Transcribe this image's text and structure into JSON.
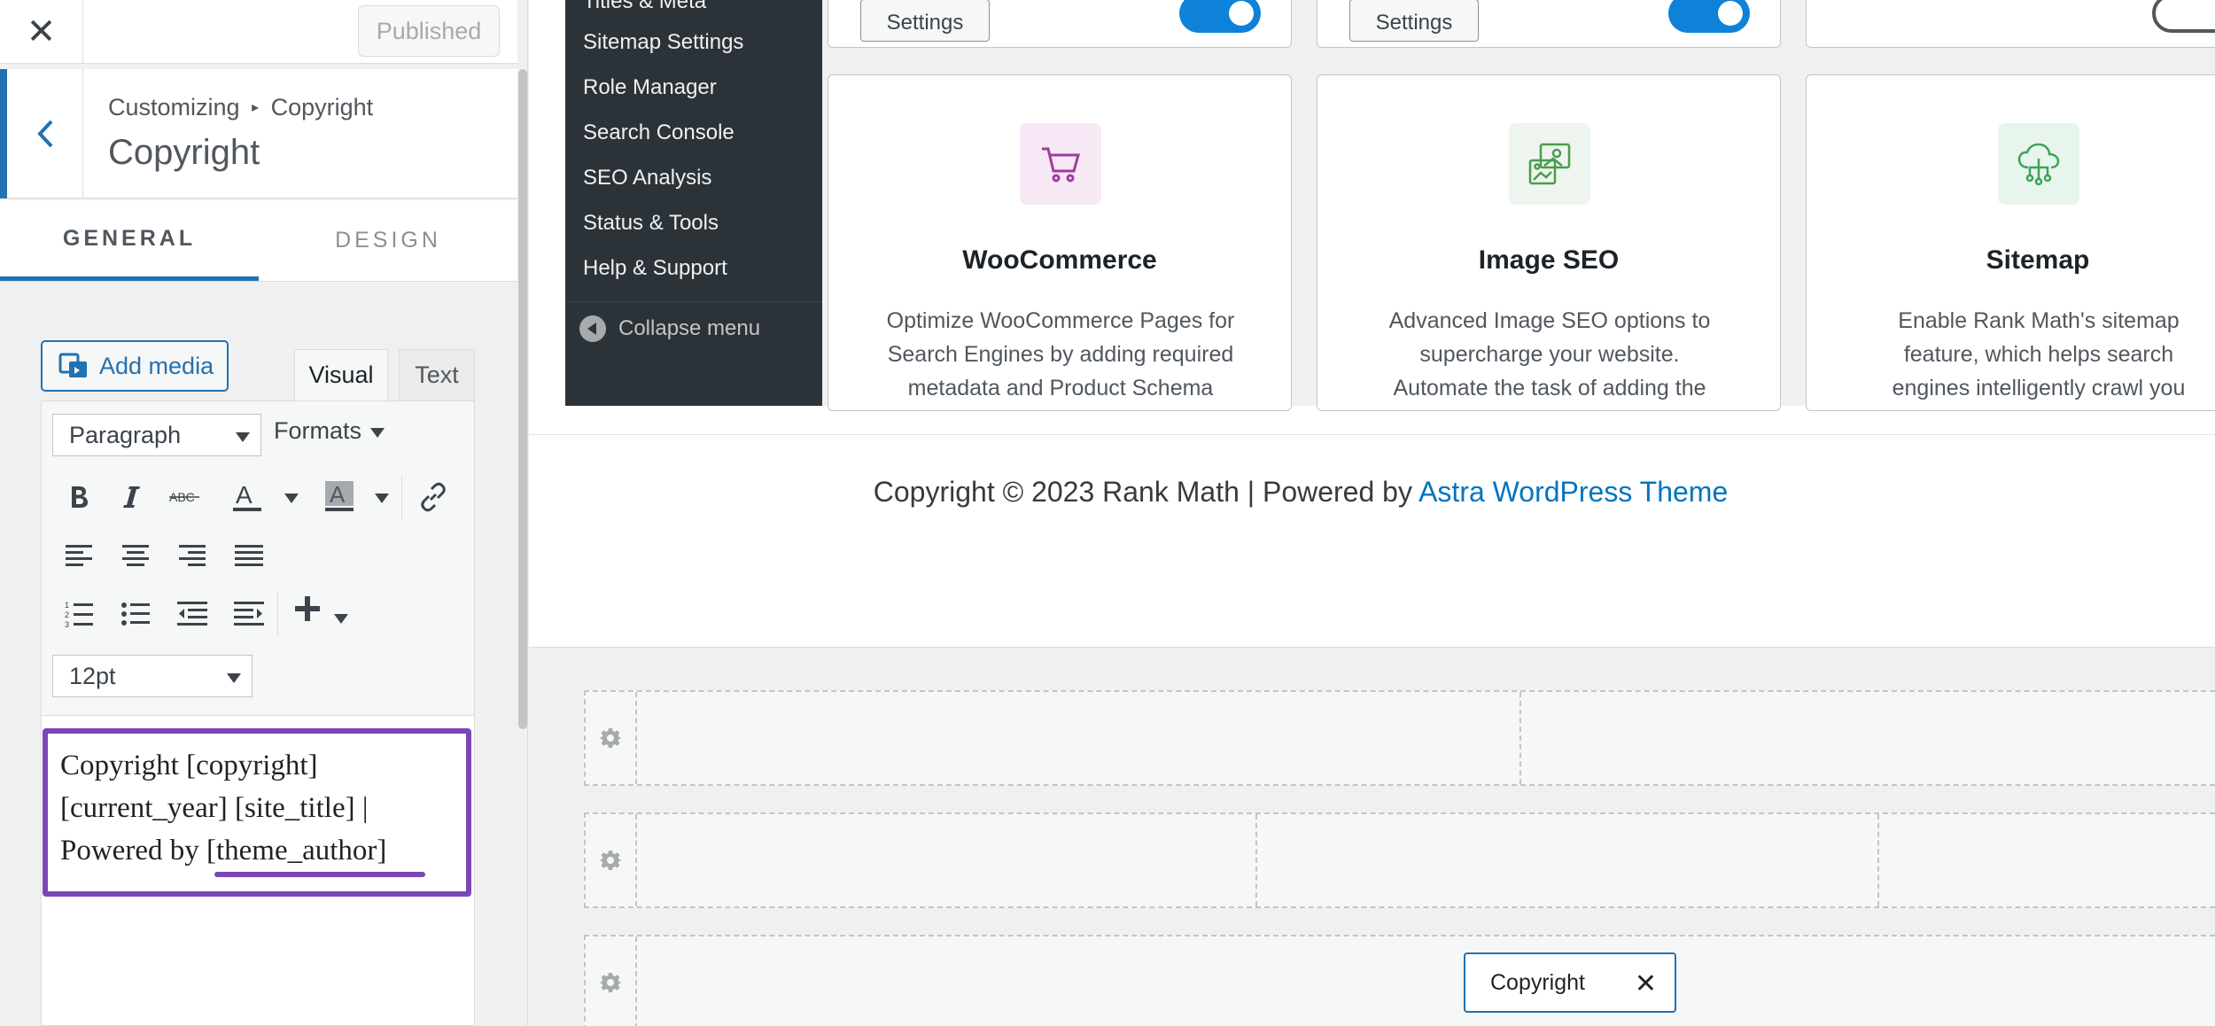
{
  "header": {
    "close_label": "✕",
    "published_label": "Published"
  },
  "section": {
    "breadcrumb_prefix": "Customizing",
    "breadcrumb_arrow": "▸",
    "breadcrumb_item": "Copyright",
    "title": "Copyright"
  },
  "tabs": [
    {
      "label": "GENERAL",
      "active": true
    },
    {
      "label": "DESIGN",
      "active": false
    }
  ],
  "editor": {
    "add_media_label": "Add media",
    "mode_visual": "Visual",
    "mode_text": "Text",
    "block_format": "Paragraph",
    "formats_label": "Formats",
    "font_size": "12pt",
    "content_lines": [
      "Copyright [copyright]",
      "[current_year] [site_title] |",
      "Powered by [theme_author]"
    ]
  },
  "wp_menu": {
    "items": [
      "Titles & Meta",
      "Sitemap Settings",
      "Role Manager",
      "Search Console",
      "SEO Analysis",
      "Status & Tools",
      "Help & Support"
    ],
    "collapse_label": "Collapse menu"
  },
  "modules": {
    "top_row": {
      "settings_label": "Settings"
    },
    "cards": [
      {
        "title": "WooCommerce",
        "icon": "cart-icon",
        "icon_bg": "#f6e9f5",
        "icon_color": "#a33aa0",
        "desc": [
          "Optimize WooCommerce Pages for",
          "Search Engines by adding required",
          "metadata and Product Schema"
        ]
      },
      {
        "title": "Image SEO",
        "icon": "image-seo-icon",
        "icon_bg": "#eef5ee",
        "icon_color": "#4a9c51",
        "desc": [
          "Advanced Image SEO options to",
          "supercharge your website.",
          "Automate the task of adding the"
        ]
      },
      {
        "title": "Sitemap",
        "icon": "sitemap-icon",
        "icon_bg": "#e8f5ec",
        "icon_color": "#3ba35a",
        "desc": [
          "Enable Rank Math's sitemap",
          "feature, which helps search",
          "engines intelligently crawl you"
        ]
      }
    ]
  },
  "footer": {
    "copyright_text": "Copyright © 2023 Rank Math | Powered by ",
    "link_text": "Astra WordPress Theme"
  },
  "builder": {
    "chip_label": "Copyright",
    "chip_close": "✕"
  },
  "colors": {
    "accent": "#2271b1",
    "highlight": "#7b46b8",
    "link": "#0274be",
    "menu_bg": "#2c3338"
  }
}
